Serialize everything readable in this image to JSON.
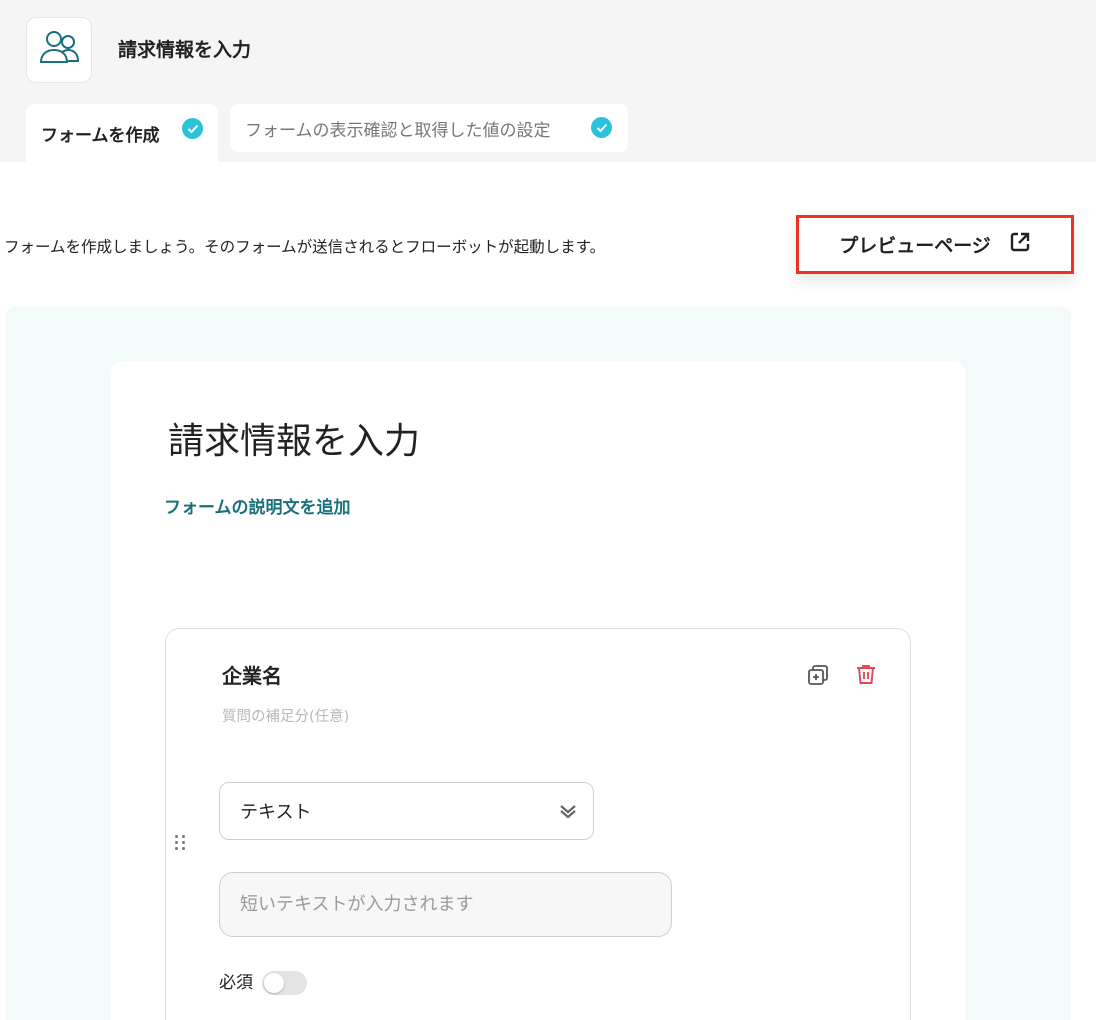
{
  "header": {
    "title": "請求情報を入力",
    "app_icon": "users-icon"
  },
  "tabs": [
    {
      "label": "フォームを作成",
      "completed": true,
      "active": true
    },
    {
      "label": "フォームの表示確認と取得した値の設定",
      "completed": true,
      "active": false
    }
  ],
  "intro_text": "フォームを作成しましょう。そのフォームが送信されるとフローボットが起動します。",
  "preview_button": {
    "label": "プレビューページ",
    "icon": "external-link-icon"
  },
  "form": {
    "title": "請求情報を入力",
    "add_description_label": "フォームの説明文を追加",
    "question": {
      "label": "企業名",
      "hint_placeholder": "質問の補足分(任意)",
      "type_value": "テキスト",
      "answer_placeholder": "短いテキストが入力されます",
      "required_label": "必須",
      "required": false
    }
  },
  "colors": {
    "check": "#2bc2d9",
    "link": "#1a6f7d",
    "highlight_border": "#ea3323",
    "delete": "#e8475a",
    "panel_bg": "#f3fbfa"
  }
}
